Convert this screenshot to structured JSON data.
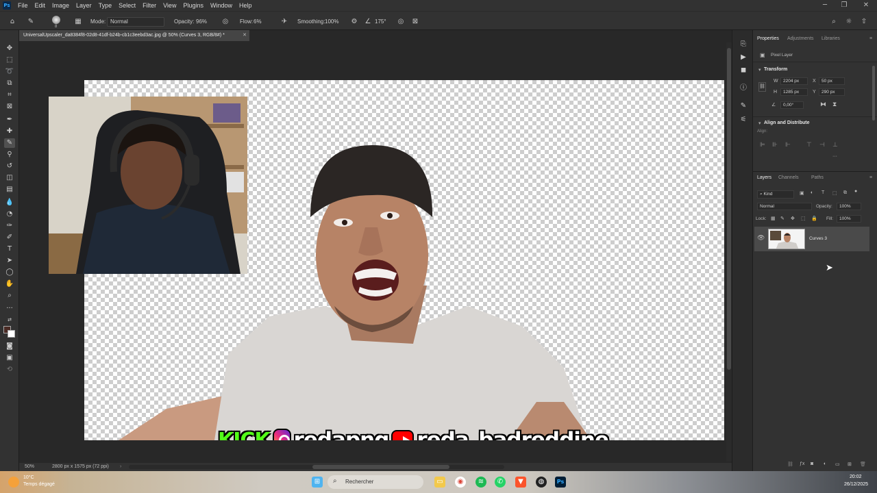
{
  "menubar": {
    "items": [
      "File",
      "Edit",
      "Image",
      "Layer",
      "Type",
      "Select",
      "Filter",
      "View",
      "Plugins",
      "Window",
      "Help"
    ]
  },
  "options": {
    "brush_size": "8",
    "mode_label": "Mode:",
    "mode_value": "Normal",
    "opacity_label": "Opacity:",
    "opacity_value": "96%",
    "flow_label": "Flow:",
    "flow_value": "6%",
    "smoothing_label": "Smoothing:",
    "smoothing_value": "100%",
    "angle_value": "175°"
  },
  "document": {
    "tab_title": "UniversalUpscaler_da8384f8-02d8-41df-b24b-cb1c3eebd3ac.jpg @ 50% (Curves 3, RGB/8#) *",
    "zoom": "50%",
    "size_info": "2800 px x 1575 px (72 ppi)"
  },
  "properties": {
    "tabs": [
      "Properties",
      "Adjustments",
      "Libraries"
    ],
    "kind": "Pixel Layer",
    "transform_title": "Transform",
    "w_label": "W",
    "w_value": "2204 px",
    "h_label": "H",
    "h_value": "1285 px",
    "x_label": "X",
    "x_value": "50 px",
    "y_label": "Y",
    "y_value": "290 px",
    "angle_value": "0,00°",
    "align_title": "Align and Distribute",
    "align_label": "Align:",
    "more": "···"
  },
  "layers": {
    "tabs": [
      "Layers",
      "Channels",
      "Paths"
    ],
    "filter_kind": "Kind",
    "blend_mode": "Normal",
    "opacity_label": "Opacity:",
    "opacity_value": "100%",
    "lock_label": "Lock:",
    "fill_label": "Fill:",
    "fill_value": "100%",
    "items": [
      {
        "name": "Curves 3",
        "visible": true
      }
    ]
  },
  "stream_banner": {
    "kick": "KICK",
    "instagram_handle": "redapng",
    "youtube_handle": "reda_badreddine"
  },
  "taskbar": {
    "weather_temp": "10°C",
    "weather_desc": "Temps dégagé",
    "search_placeholder": "Rechercher",
    "time": "20:02",
    "date": "26/12/2025"
  },
  "colors": {
    "accent_kick": "#53fc18",
    "instagram": "#e1306c",
    "youtube": "#ff0000",
    "ps_blue": "#31a8ff"
  }
}
